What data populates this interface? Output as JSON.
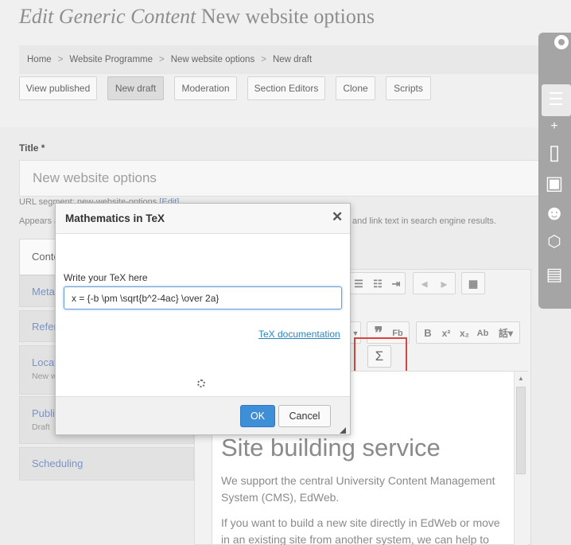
{
  "header": {
    "title_italic": "Edit Generic Content",
    "title_rest": "New website options"
  },
  "breadcrumb": [
    "Home",
    "Website Programme",
    "New website options",
    "New draft"
  ],
  "tabs": [
    {
      "label": "View published"
    },
    {
      "label": "New draft"
    },
    {
      "label": "Moderation"
    },
    {
      "label": "Section Editors"
    },
    {
      "label": "Clone"
    },
    {
      "label": "Scripts"
    }
  ],
  "form": {
    "title_label": "Title *",
    "title_value": "New website options",
    "url_prefix": "URL segment: new-website-options",
    "url_edit": "[Edit]",
    "appears_prefix": "Appears a",
    "appears_tail": "and link text in search engine results."
  },
  "sidetabs": [
    {
      "label": "Conte",
      "sub": ""
    },
    {
      "label": "Meta",
      "sub": ""
    },
    {
      "label": "Refer",
      "sub": ""
    },
    {
      "label": "Locat",
      "sub": "New w"
    },
    {
      "label": "Publi",
      "sub": "Draft"
    },
    {
      "label": "Scheduling",
      "sub": ""
    }
  ],
  "editor": {
    "toolbar": {
      "sigma": "Σ",
      "quote": "❞",
      "bold": "B",
      "sup": "x²",
      "sub": "x₂"
    },
    "heading": "Site building service",
    "para1": [
      "We support the central University Content Management",
      "System (CMS), EdWeb."
    ],
    "para2": [
      "If you want to build a new site directly in EdWeb or move",
      "in an existing site from another system, we can help to"
    ]
  },
  "modal": {
    "title": "Mathematics in TeX",
    "close": "✕",
    "label": "Write your TeX here",
    "tex_value": "x = {-b \\pm \\sqrt{b^2-4ac} \\over 2a}",
    "doc_link": "TeX documentation",
    "ok": "OK",
    "cancel": "Cancel"
  },
  "colors": {
    "accent": "#3f8fd8",
    "highlight": "#d9443e",
    "link": "#2a86c0"
  },
  "right_toolbar": {
    "icons": [
      "settings-icon",
      "list-icon",
      "add-page-icon",
      "image-icon",
      "user-info-icon",
      "code-icon",
      "video-icon"
    ]
  }
}
